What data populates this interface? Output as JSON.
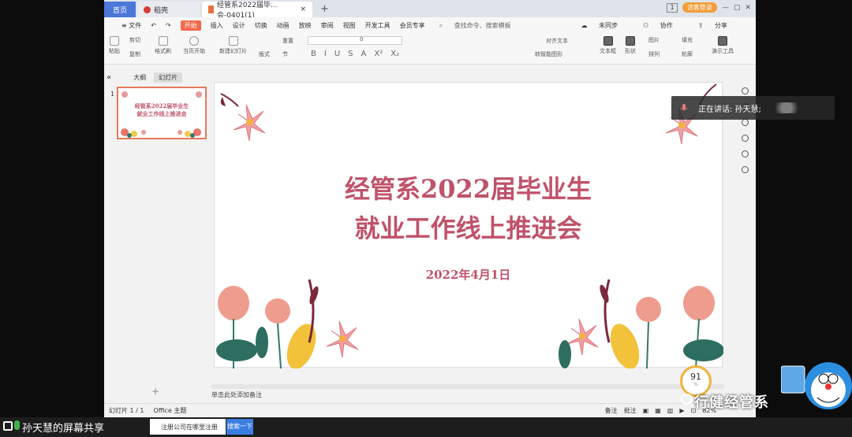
{
  "tabs": {
    "home": "首页",
    "daoke": "稻壳",
    "doc": "经管系2022届毕...会-0401(1)",
    "plus": "+"
  },
  "topright": {
    "page_num": "1",
    "visitor": "访客登录"
  },
  "menu": {
    "file": "≡ 文件",
    "active": "开始",
    "items": [
      "插入",
      "设计",
      "切换",
      "动画",
      "放映",
      "审阅",
      "视图",
      "开发工具",
      "会员专享"
    ],
    "search": "查找命令、搜索模板",
    "unsync": "未同步",
    "collab": "协作",
    "share": "分享"
  },
  "ribbon": {
    "paste": "粘贴",
    "cut": "剪切",
    "copy": "复制",
    "format_painter": "格式刷",
    "from_start": "当页开始",
    "new_slide": "新建幻灯片",
    "layout": "版式",
    "section": "节",
    "reset": "重置",
    "font_size": "0",
    "align_text": "对齐文本",
    "to_smartart": "转智能图形",
    "textbox": "文本框",
    "shape": "形状",
    "picture": "图片",
    "arrange": "排列",
    "fill": "填充",
    "outline": "轮廓",
    "presenter": "演示工具"
  },
  "left_panel": {
    "collapse": "«",
    "outline_tab": "大纲",
    "slides_tab": "幻灯片",
    "slide_number": "1",
    "thumb_line1": "经管系2022届毕业生",
    "thumb_line2": "就业工作线上推进会",
    "add": "+"
  },
  "slide": {
    "title_line1": "经管系2022届毕业生",
    "title_line2": "就业工作线上推进会",
    "date": "2022年4月1日"
  },
  "notes": "单击此处添加备注",
  "status": {
    "slide_count": "幻灯片 1 / 1",
    "theme": "Office 主题",
    "notes_btn": "备注",
    "comment_btn": "批注",
    "zoom": "82%"
  },
  "overlay": {
    "speaking": "正在讲话: 孙天慧;",
    "perf_value": "91",
    "perf_unit": "%",
    "watermark": "行健经管系"
  },
  "taskbar": {
    "share_label": "孙天慧的屏幕共享",
    "ie_task": "注册公司在哪里注册",
    "search_btn": "搜索一下"
  }
}
